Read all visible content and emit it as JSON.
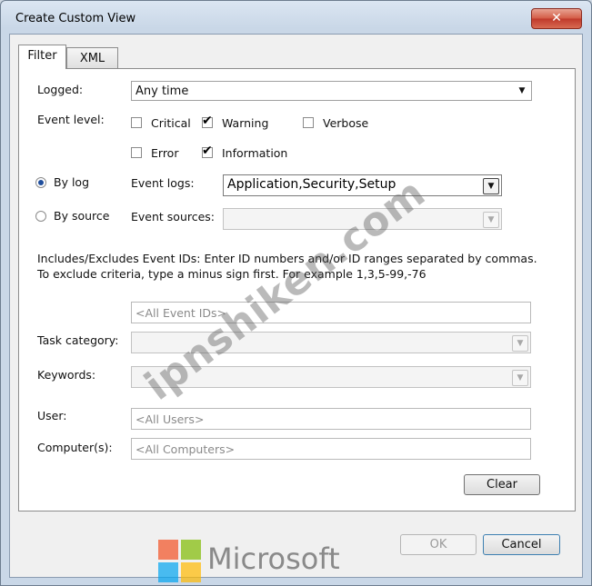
{
  "window": {
    "title": "Create Custom View",
    "close_symbol": "✕"
  },
  "tabs": [
    {
      "label": "Filter"
    },
    {
      "label": "XML"
    }
  ],
  "filter": {
    "logged_label": "Logged:",
    "logged_value": "Any time",
    "event_level_label": "Event level:",
    "levels": {
      "critical": {
        "label": "Critical",
        "checked": false
      },
      "warning": {
        "label": "Warning",
        "checked": true
      },
      "verbose": {
        "label": "Verbose",
        "checked": false
      },
      "error": {
        "label": "Error",
        "checked": false
      },
      "information": {
        "label": "Information",
        "checked": true
      }
    },
    "by_log_label": "By log",
    "by_source_label": "By source",
    "event_logs_label": "Event logs:",
    "event_logs_value": "Application,Security,Setup",
    "event_sources_label": "Event sources:",
    "event_ids_description": "Includes/Excludes Event IDs: Enter ID numbers and/or ID ranges separated by commas. To exclude criteria, type a minus sign first. For example 1,3,5-99,-76",
    "event_ids_placeholder": "<All Event IDs>",
    "task_category_label": "Task category:",
    "keywords_label": "Keywords:",
    "user_label": "User:",
    "user_placeholder": "<All Users>",
    "computer_label": "Computer(s):",
    "computer_placeholder": "<All Computers>",
    "clear_label": "Clear"
  },
  "footer": {
    "ok_label": "OK",
    "cancel_label": "Cancel"
  },
  "watermark": {
    "text": "ipnshiken.com"
  },
  "brand": {
    "text": "Microsoft",
    "colors": [
      "#f25022",
      "#7fba00",
      "#00a4ef",
      "#ffb900"
    ]
  }
}
